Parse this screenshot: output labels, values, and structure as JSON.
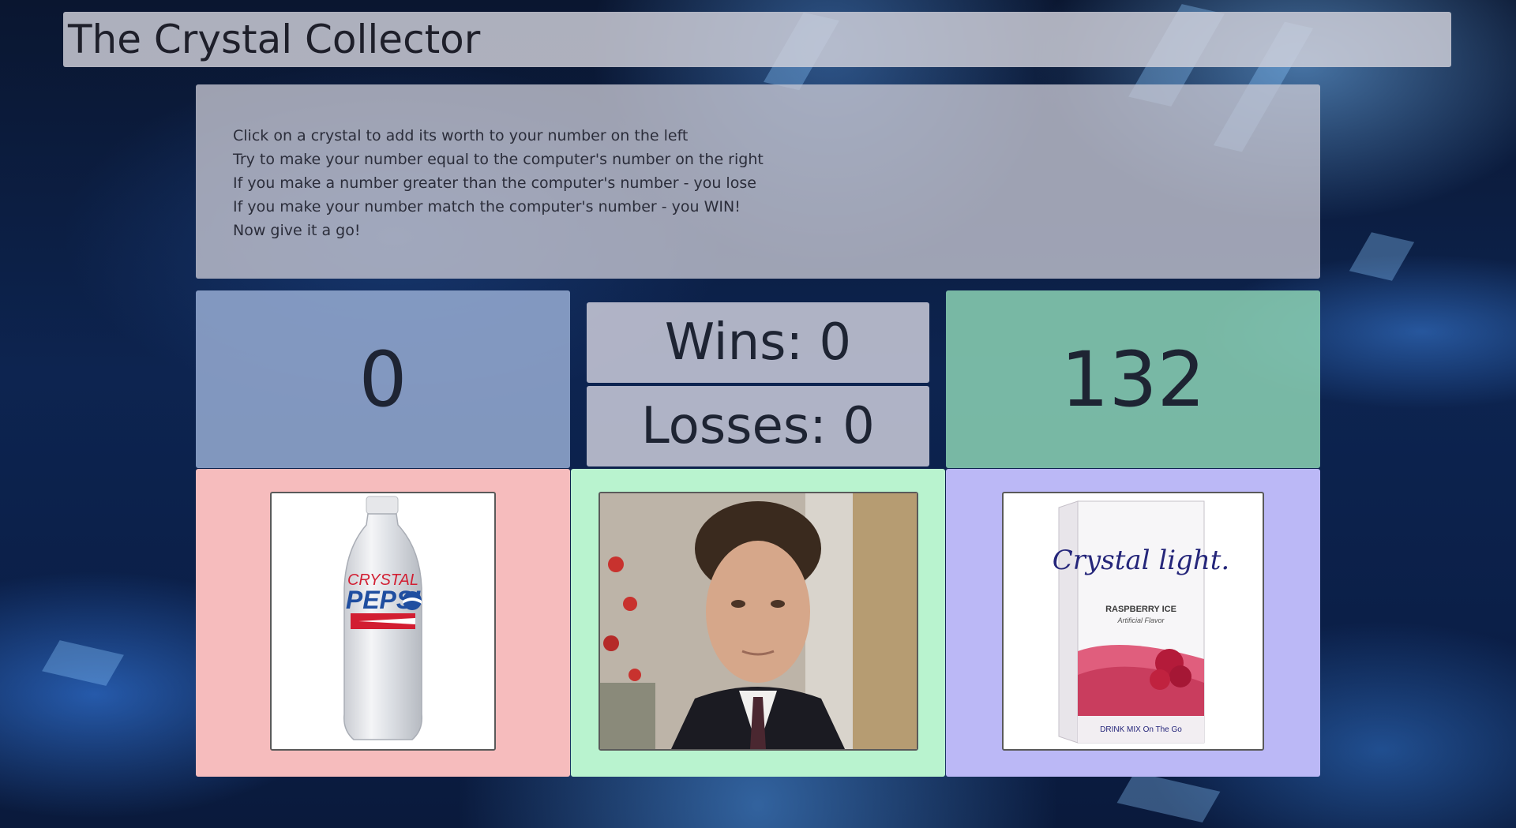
{
  "header": {
    "title": "The Crystal Collector"
  },
  "instructions": [
    "Click on a crystal to add its worth to your number on the left",
    "Try to make your number equal to the computer's number on the right",
    "If you make a number greater than the computer's number - you lose",
    "If you make your number match the computer's number - you WIN!",
    "Now give it a go!"
  ],
  "scoreboard": {
    "your_number": "0",
    "wins_text": "Wins: 0",
    "losses_text": "Losses: 0",
    "target_number": "132"
  },
  "crystals": [
    {
      "name": "crystal-pepsi",
      "label_line1": "CRYSTAL",
      "label_line2": "PEPSI",
      "panel_color": "#f6bcbd"
    },
    {
      "name": "billy-crystal",
      "panel_color": "#b9f3cf"
    },
    {
      "name": "crystal-light",
      "brand": "Crystal light.",
      "flavor": "RASPBERRY ICE",
      "sub": "Artificial Flavor",
      "footer": "DRINK MIX On The Go",
      "panel_color": "#bbb8f6"
    }
  ]
}
